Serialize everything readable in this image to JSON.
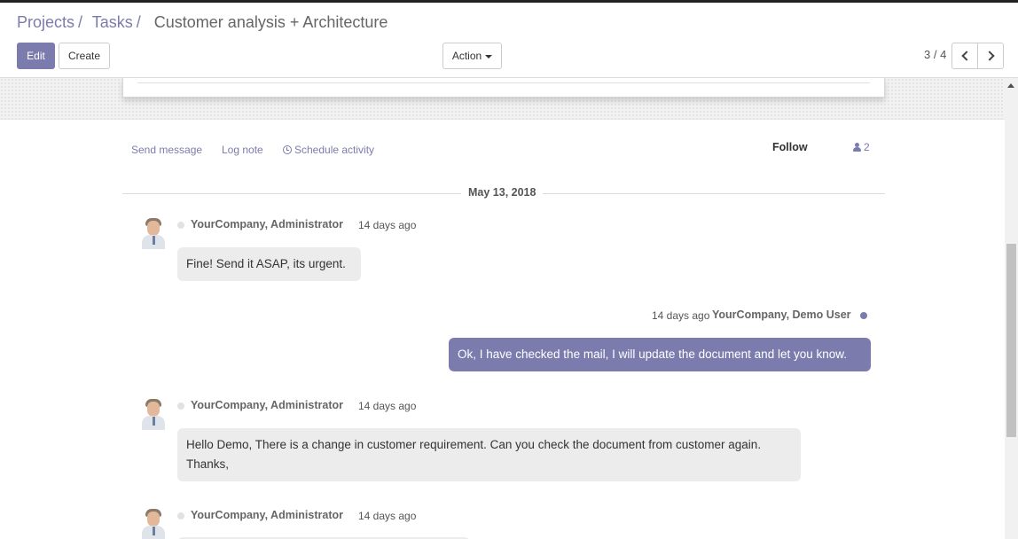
{
  "breadcrumb": {
    "items": [
      "Projects",
      "Tasks"
    ],
    "separator": "/",
    "current": "Customer analysis + Architecture"
  },
  "toolbar": {
    "edit_label": "Edit",
    "create_label": "Create",
    "action_label": "Action"
  },
  "pager": {
    "value": "3 / 4"
  },
  "chatter": {
    "send_message": "Send message",
    "log_note": "Log note",
    "schedule_activity": "Schedule activity",
    "follow_label": "Follow",
    "followers_count": "2",
    "date_separator": "May 13, 2018",
    "messages": [
      {
        "author": "YourCompany, Administrator",
        "time": "14 days ago",
        "body": "Fine! Send it ASAP, its urgent.",
        "direction": "incoming"
      },
      {
        "author": "YourCompany, Demo User",
        "time": "14 days ago",
        "body": "Ok, I have checked the mail, I will update the document and let you know.",
        "direction": "outgoing"
      },
      {
        "author": "YourCompany, Administrator",
        "time": "14 days ago",
        "body": "Hello Demo, There is a change in customer requirement. Can you check the document from customer again. Thanks,",
        "direction": "incoming"
      },
      {
        "author": "YourCompany, Administrator",
        "time": "14 days ago",
        "body": "",
        "direction": "incoming"
      }
    ]
  },
  "colors": {
    "brand": "#7c7bad",
    "bubble_in": "#ececec",
    "bubble_out": "#7c7bad"
  },
  "icons": {
    "pager_prev": "chevron-left-icon",
    "pager_next": "chevron-right-icon",
    "schedule": "clock-icon",
    "followers": "user-icon",
    "action_caret": "caret-down-icon"
  }
}
